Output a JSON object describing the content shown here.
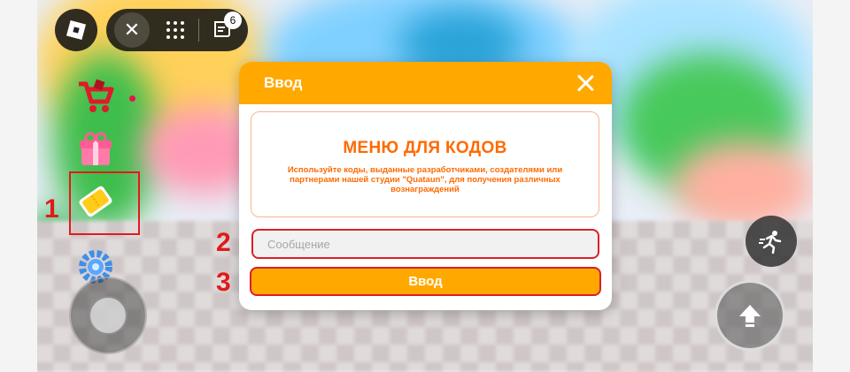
{
  "dialog": {
    "title": "Ввод",
    "heading": "МЕНЮ ДЛЯ КОДОВ",
    "description": "Используйте коды, выданные разработчиками, создателями или партнерами нашей студии \"Quataun\", для получения различных вознаграждений",
    "input_placeholder": "Сообщение",
    "input_value": "",
    "submit_label": "Ввод"
  },
  "topbar": {
    "notification_count": "6"
  },
  "markers": {
    "step1": "1",
    "step2": "2",
    "step3": "3"
  },
  "side_menu": {
    "items": [
      {
        "icon": "shop-cart-icon"
      },
      {
        "icon": "gift-icon"
      },
      {
        "icon": "codes-ticket-icon"
      },
      {
        "icon": "settings-gear-icon"
      }
    ]
  },
  "colors": {
    "accent": "#ffa800",
    "heading": "#ff6a00",
    "annotation": "#e21a1a"
  }
}
